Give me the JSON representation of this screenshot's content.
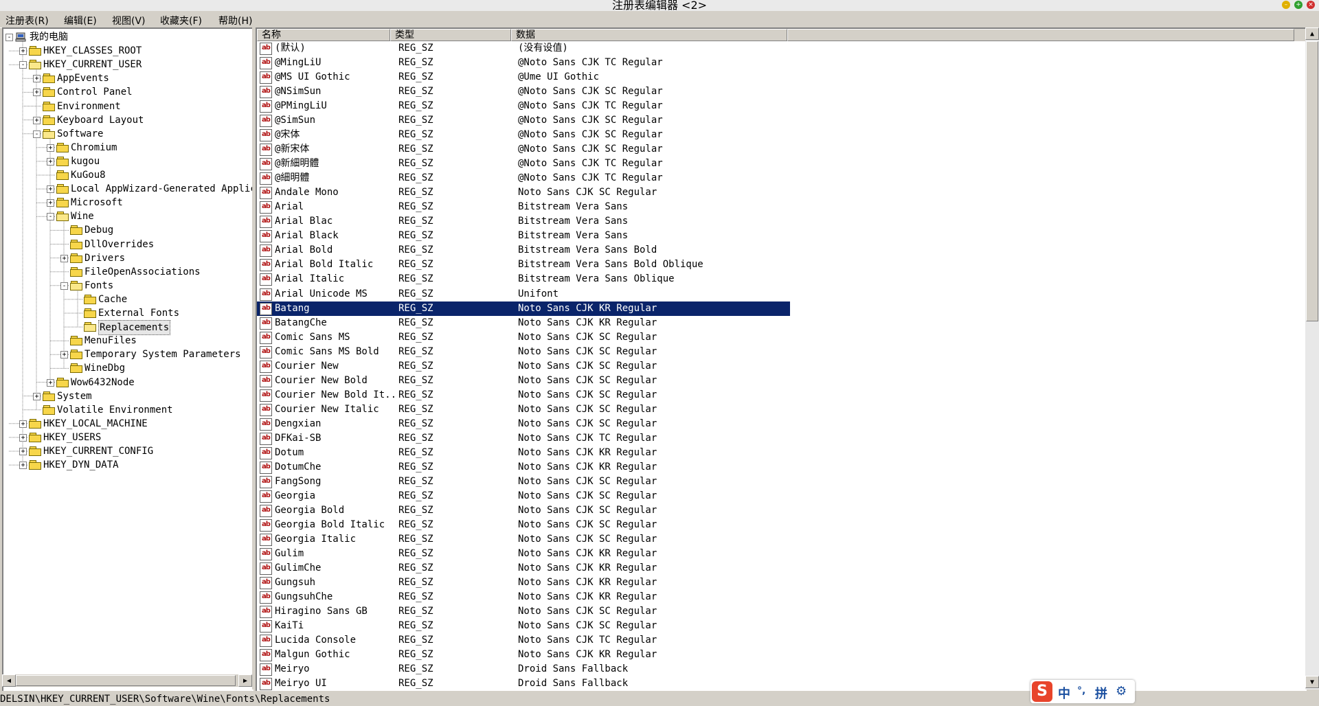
{
  "window": {
    "title": "注册表编辑器 <2>"
  },
  "menu": [
    "注册表(R)",
    "编辑(E)",
    "视图(V)",
    "收藏夹(F)",
    "帮助(H)"
  ],
  "tree": [
    {
      "label": "我的电脑",
      "depth": 0,
      "exp": "-",
      "icon": "computer"
    },
    {
      "label": "HKEY_CLASSES_ROOT",
      "depth": 1,
      "exp": "+"
    },
    {
      "label": "HKEY_CURRENT_USER",
      "depth": 1,
      "exp": "-",
      "open": true
    },
    {
      "label": "AppEvents",
      "depth": 2,
      "exp": "+"
    },
    {
      "label": "Control Panel",
      "depth": 2,
      "exp": "+"
    },
    {
      "label": "Environment",
      "depth": 2,
      "exp": ""
    },
    {
      "label": "Keyboard Layout",
      "depth": 2,
      "exp": "+"
    },
    {
      "label": "Software",
      "depth": 2,
      "exp": "-",
      "open": true
    },
    {
      "label": "Chromium",
      "depth": 3,
      "exp": "+"
    },
    {
      "label": "kugou",
      "depth": 3,
      "exp": "+"
    },
    {
      "label": "KuGou8",
      "depth": 3,
      "exp": ""
    },
    {
      "label": "Local AppWizard-Generated Applica",
      "depth": 3,
      "exp": "+"
    },
    {
      "label": "Microsoft",
      "depth": 3,
      "exp": "+"
    },
    {
      "label": "Wine",
      "depth": 3,
      "exp": "-",
      "open": true
    },
    {
      "label": "Debug",
      "depth": 4,
      "exp": ""
    },
    {
      "label": "DllOverrides",
      "depth": 4,
      "exp": ""
    },
    {
      "label": "Drivers",
      "depth": 4,
      "exp": "+"
    },
    {
      "label": "FileOpenAssociations",
      "depth": 4,
      "exp": ""
    },
    {
      "label": "Fonts",
      "depth": 4,
      "exp": "-",
      "open": true
    },
    {
      "label": "Cache",
      "depth": 5,
      "exp": ""
    },
    {
      "label": "External Fonts",
      "depth": 5,
      "exp": ""
    },
    {
      "label": "Replacements",
      "depth": 5,
      "exp": "",
      "selected": true,
      "open": true
    },
    {
      "label": "MenuFiles",
      "depth": 4,
      "exp": ""
    },
    {
      "label": "Temporary System Parameters",
      "depth": 4,
      "exp": "+"
    },
    {
      "label": "WineDbg",
      "depth": 4,
      "exp": ""
    },
    {
      "label": "Wow6432Node",
      "depth": 3,
      "exp": "+"
    },
    {
      "label": "System",
      "depth": 2,
      "exp": "+"
    },
    {
      "label": "Volatile Environment",
      "depth": 2,
      "exp": ""
    },
    {
      "label": "HKEY_LOCAL_MACHINE",
      "depth": 1,
      "exp": "+"
    },
    {
      "label": "HKEY_USERS",
      "depth": 1,
      "exp": "+"
    },
    {
      "label": "HKEY_CURRENT_CONFIG",
      "depth": 1,
      "exp": "+"
    },
    {
      "label": "HKEY_DYN_DATA",
      "depth": 1,
      "exp": "+"
    }
  ],
  "columns": [
    "名称",
    "类型",
    "数据"
  ],
  "values": [
    [
      "(默认)",
      "REG_SZ",
      "(没有设值)"
    ],
    [
      "@MingLiU",
      "REG_SZ",
      "@Noto Sans CJK TC Regular"
    ],
    [
      "@MS UI Gothic",
      "REG_SZ",
      "@Ume UI Gothic"
    ],
    [
      "@NSimSun",
      "REG_SZ",
      "@Noto Sans CJK SC Regular"
    ],
    [
      "@PMingLiU",
      "REG_SZ",
      "@Noto Sans CJK TC Regular"
    ],
    [
      "@SimSun",
      "REG_SZ",
      "@Noto Sans CJK SC Regular"
    ],
    [
      "@宋体",
      "REG_SZ",
      "@Noto Sans CJK SC Regular"
    ],
    [
      "@新宋体",
      "REG_SZ",
      "@Noto Sans CJK SC Regular"
    ],
    [
      "@新細明體",
      "REG_SZ",
      "@Noto Sans CJK TC Regular"
    ],
    [
      "@細明體",
      "REG_SZ",
      "@Noto Sans CJK TC Regular"
    ],
    [
      "Andale Mono",
      "REG_SZ",
      "Noto Sans CJK SC Regular"
    ],
    [
      "Arial",
      "REG_SZ",
      "Bitstream Vera Sans"
    ],
    [
      "Arial Blac",
      "REG_SZ",
      "Bitstream Vera Sans"
    ],
    [
      "Arial Black",
      "REG_SZ",
      "Bitstream Vera Sans"
    ],
    [
      "Arial Bold",
      "REG_SZ",
      "Bitstream Vera Sans Bold"
    ],
    [
      "Arial Bold Italic",
      "REG_SZ",
      "Bitstream Vera Sans Bold Oblique"
    ],
    [
      "Arial Italic",
      "REG_SZ",
      "Bitstream Vera Sans Oblique"
    ],
    [
      "Arial Unicode MS",
      "REG_SZ",
      "Unifont"
    ],
    [
      "Batang",
      "REG_SZ",
      "Noto Sans CJK KR Regular"
    ],
    [
      "BatangChe",
      "REG_SZ",
      "Noto Sans CJK KR Regular"
    ],
    [
      "Comic Sans MS",
      "REG_SZ",
      "Noto Sans CJK SC Regular"
    ],
    [
      "Comic Sans MS Bold",
      "REG_SZ",
      "Noto Sans CJK SC Regular"
    ],
    [
      "Courier New",
      "REG_SZ",
      "Noto Sans CJK SC Regular"
    ],
    [
      "Courier New Bold",
      "REG_SZ",
      "Noto Sans CJK SC Regular"
    ],
    [
      "Courier New Bold It...",
      "REG_SZ",
      "Noto Sans CJK SC Regular"
    ],
    [
      "Courier New Italic",
      "REG_SZ",
      "Noto Sans CJK SC Regular"
    ],
    [
      "Dengxian",
      "REG_SZ",
      "Noto Sans CJK SC Regular"
    ],
    [
      "DFKai-SB",
      "REG_SZ",
      "Noto Sans CJK TC Regular"
    ],
    [
      "Dotum",
      "REG_SZ",
      "Noto Sans CJK KR Regular"
    ],
    [
      "DotumChe",
      "REG_SZ",
      "Noto Sans CJK KR Regular"
    ],
    [
      "FangSong",
      "REG_SZ",
      "Noto Sans CJK SC Regular"
    ],
    [
      "Georgia",
      "REG_SZ",
      "Noto Sans CJK SC Regular"
    ],
    [
      "Georgia Bold",
      "REG_SZ",
      "Noto Sans CJK SC Regular"
    ],
    [
      "Georgia Bold Italic",
      "REG_SZ",
      "Noto Sans CJK SC Regular"
    ],
    [
      "Georgia Italic",
      "REG_SZ",
      "Noto Sans CJK SC Regular"
    ],
    [
      "Gulim",
      "REG_SZ",
      "Noto Sans CJK KR Regular"
    ],
    [
      "GulimChe",
      "REG_SZ",
      "Noto Sans CJK KR Regular"
    ],
    [
      "Gungsuh",
      "REG_SZ",
      "Noto Sans CJK KR Regular"
    ],
    [
      "GungsuhChe",
      "REG_SZ",
      "Noto Sans CJK KR Regular"
    ],
    [
      "Hiragino Sans GB",
      "REG_SZ",
      "Noto Sans CJK SC Regular"
    ],
    [
      "KaiTi",
      "REG_SZ",
      "Noto Sans CJK SC Regular"
    ],
    [
      "Lucida Console",
      "REG_SZ",
      "Noto Sans CJK TC Regular"
    ],
    [
      "Malgun Gothic",
      "REG_SZ",
      "Noto Sans CJK KR Regular"
    ],
    [
      "Meiryo",
      "REG_SZ",
      "Droid Sans Fallback"
    ],
    [
      "Meiryo UI",
      "REG_SZ",
      "Droid Sans Fallback"
    ]
  ],
  "selected_value": "Batang",
  "value_icon": "ab-icon",
  "status": "DELSIN\\HKEY_CURRENT_USER\\Software\\Wine\\Fonts\\Replacements",
  "ime": {
    "mode": "中",
    "punct": "°,",
    "pinyin": "拼",
    "icon": "gear-icon"
  },
  "colors": {
    "selection": "#0a246a",
    "folder": "#f7d64a",
    "background": "#d4d0c8"
  }
}
